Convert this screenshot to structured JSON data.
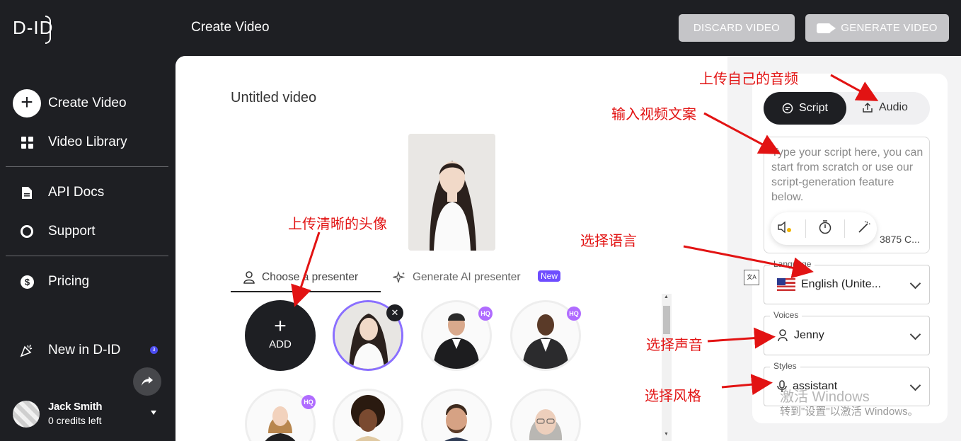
{
  "header": {
    "logo": "D-ID",
    "page_title": "Create Video",
    "discard_label": "DISCARD VIDEO",
    "generate_label": "GENERATE VIDEO"
  },
  "sidebar": {
    "create_label": "Create Video",
    "library_label": "Video Library",
    "api_label": "API Docs",
    "support_label": "Support",
    "pricing_label": "Pricing",
    "new_label": "New in D-ID",
    "new_count": "3",
    "user_name": "Jack Smith",
    "credits": "0 credits left"
  },
  "main": {
    "video_title": "Untitled video",
    "tabs": [
      {
        "label": "Choose a presenter"
      },
      {
        "label": "Generate AI presenter",
        "badge": "New"
      }
    ],
    "add_label": "ADD",
    "hq_label": "HQ"
  },
  "script_panel": {
    "script_tab": "Script",
    "audio_tab": "Audio",
    "placeholder": "Type your script here, you can start from scratch or use our script-generation feature below.",
    "char_count": "3875 C...",
    "language_label": "Language",
    "language_value": "English (Unite...",
    "voices_label": "Voices",
    "voice_value": "Jenny",
    "styles_label": "Styles",
    "style_value": "assistant"
  },
  "annotations": {
    "upload_audio": "上传自己的音频",
    "input_script": "输入视频文案",
    "upload_avatar": "上传清晰的头像",
    "choose_language": "选择语言",
    "choose_voice": "选择声音",
    "choose_style": "选择风格"
  },
  "watermark": {
    "line1": "激活 Windows",
    "line2": "转到\"设置\"以激活 Windows。"
  },
  "colors": {
    "sidebar_bg": "#1e1f23",
    "accent_purple": "#8a6fff",
    "hq_badge": "#b06cff",
    "annotation_red": "#e21313"
  }
}
